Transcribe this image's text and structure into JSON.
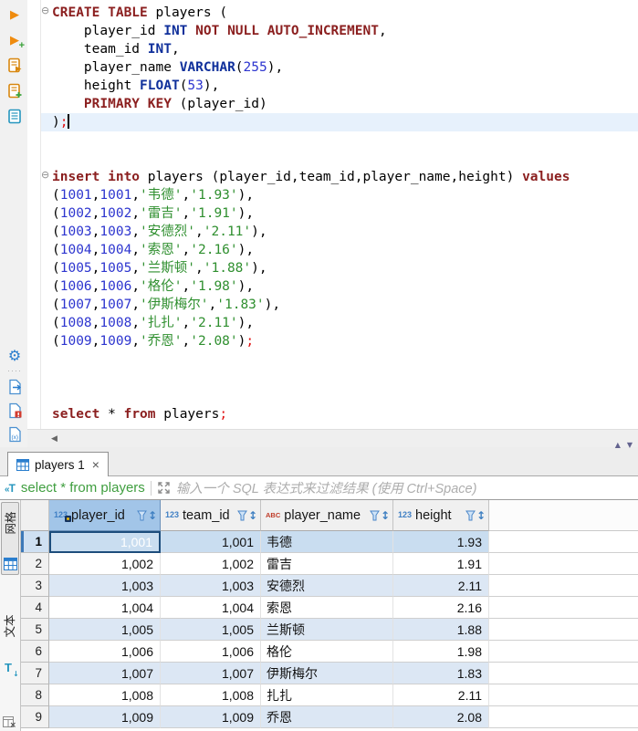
{
  "icons": {
    "play": "▶",
    "plus": "+",
    "gear": "⚙",
    "dots": "····",
    "fold": "⊖",
    "scroll_left": "◀",
    "close": "×",
    "sort": "↕",
    "panel_up": "▲",
    "panel_down": "▼",
    "filter_chevrons": "«",
    "filter_T": "T",
    "text_T": "T",
    "text_arrow": "↓"
  },
  "editor": {
    "lines": [
      {
        "fold": true,
        "tokens": [
          [
            "k",
            "CREATE TABLE"
          ],
          [
            "p",
            " players ("
          ]
        ]
      },
      {
        "tokens": [
          [
            "p",
            "    player_id "
          ],
          [
            "t",
            "INT"
          ],
          [
            "p",
            " "
          ],
          [
            "k",
            "NOT NULL AUTO_INCREMENT"
          ],
          [
            "p",
            ","
          ]
        ]
      },
      {
        "tokens": [
          [
            "p",
            "    team_id "
          ],
          [
            "t",
            "INT"
          ],
          [
            "p",
            ","
          ]
        ]
      },
      {
        "tokens": [
          [
            "p",
            "    player_name "
          ],
          [
            "t",
            "VARCHAR"
          ],
          [
            "p",
            "("
          ],
          [
            "n",
            "255"
          ],
          [
            "p",
            "),"
          ]
        ]
      },
      {
        "tokens": [
          [
            "p",
            "    height "
          ],
          [
            "t",
            "FLOAT"
          ],
          [
            "p",
            "("
          ],
          [
            "n",
            "53"
          ],
          [
            "p",
            "),"
          ]
        ]
      },
      {
        "tokens": [
          [
            "p",
            "    "
          ],
          [
            "k",
            "PRIMARY KEY"
          ],
          [
            "p",
            " (player_id)"
          ]
        ]
      },
      {
        "tokens": [
          [
            "p",
            ")"
          ],
          [
            "d",
            ";"
          ]
        ],
        "cursor": true
      },
      {
        "tokens": []
      },
      {
        "tokens": []
      },
      {
        "fold": true,
        "tokens": [
          [
            "k",
            "insert into"
          ],
          [
            "p",
            " players (player_id,team_id,player_name,height) "
          ],
          [
            "k",
            "values"
          ]
        ]
      },
      {
        "tokens": [
          [
            "p",
            "("
          ],
          [
            "n",
            "1001"
          ],
          [
            "p",
            ","
          ],
          [
            "n",
            "1001"
          ],
          [
            "p",
            ","
          ],
          [
            "s",
            "'韦德'"
          ],
          [
            "p",
            ","
          ],
          [
            "s",
            "'1.93'"
          ],
          [
            "p",
            "),"
          ]
        ]
      },
      {
        "tokens": [
          [
            "p",
            "("
          ],
          [
            "n",
            "1002"
          ],
          [
            "p",
            ","
          ],
          [
            "n",
            "1002"
          ],
          [
            "p",
            ","
          ],
          [
            "s",
            "'雷吉'"
          ],
          [
            "p",
            ","
          ],
          [
            "s",
            "'1.91'"
          ],
          [
            "p",
            "),"
          ]
        ]
      },
      {
        "tokens": [
          [
            "p",
            "("
          ],
          [
            "n",
            "1003"
          ],
          [
            "p",
            ","
          ],
          [
            "n",
            "1003"
          ],
          [
            "p",
            ","
          ],
          [
            "s",
            "'安德烈'"
          ],
          [
            "p",
            ","
          ],
          [
            "s",
            "'2.11'"
          ],
          [
            "p",
            "),"
          ]
        ]
      },
      {
        "tokens": [
          [
            "p",
            "("
          ],
          [
            "n",
            "1004"
          ],
          [
            "p",
            ","
          ],
          [
            "n",
            "1004"
          ],
          [
            "p",
            ","
          ],
          [
            "s",
            "'索恩'"
          ],
          [
            "p",
            ","
          ],
          [
            "s",
            "'2.16'"
          ],
          [
            "p",
            "),"
          ]
        ]
      },
      {
        "tokens": [
          [
            "p",
            "("
          ],
          [
            "n",
            "1005"
          ],
          [
            "p",
            ","
          ],
          [
            "n",
            "1005"
          ],
          [
            "p",
            ","
          ],
          [
            "s",
            "'兰斯顿'"
          ],
          [
            "p",
            ","
          ],
          [
            "s",
            "'1.88'"
          ],
          [
            "p",
            "),"
          ]
        ]
      },
      {
        "tokens": [
          [
            "p",
            "("
          ],
          [
            "n",
            "1006"
          ],
          [
            "p",
            ","
          ],
          [
            "n",
            "1006"
          ],
          [
            "p",
            ","
          ],
          [
            "s",
            "'格伦'"
          ],
          [
            "p",
            ","
          ],
          [
            "s",
            "'1.98'"
          ],
          [
            "p",
            "),"
          ]
        ]
      },
      {
        "tokens": [
          [
            "p",
            "("
          ],
          [
            "n",
            "1007"
          ],
          [
            "p",
            ","
          ],
          [
            "n",
            "1007"
          ],
          [
            "p",
            ","
          ],
          [
            "s",
            "'伊斯梅尔'"
          ],
          [
            "p",
            ","
          ],
          [
            "s",
            "'1.83'"
          ],
          [
            "p",
            "),"
          ]
        ]
      },
      {
        "tokens": [
          [
            "p",
            "("
          ],
          [
            "n",
            "1008"
          ],
          [
            "p",
            ","
          ],
          [
            "n",
            "1008"
          ],
          [
            "p",
            ","
          ],
          [
            "s",
            "'扎扎'"
          ],
          [
            "p",
            ","
          ],
          [
            "s",
            "'2.11'"
          ],
          [
            "p",
            "),"
          ]
        ]
      },
      {
        "tokens": [
          [
            "p",
            "("
          ],
          [
            "n",
            "1009"
          ],
          [
            "p",
            ","
          ],
          [
            "n",
            "1009"
          ],
          [
            "p",
            ","
          ],
          [
            "s",
            "'乔恩'"
          ],
          [
            "p",
            ","
          ],
          [
            "s",
            "'2.08'"
          ],
          [
            "p",
            ")"
          ],
          [
            "d",
            ";"
          ]
        ]
      },
      {
        "tokens": []
      },
      {
        "tokens": []
      },
      {
        "tokens": []
      },
      {
        "tokens": [
          [
            "k",
            "select"
          ],
          [
            "p",
            " * "
          ],
          [
            "k",
            "from"
          ],
          [
            "p",
            " players"
          ],
          [
            "d",
            ";"
          ]
        ]
      }
    ]
  },
  "results": {
    "tab": {
      "label": "players 1"
    },
    "filter": {
      "query": "select * from players",
      "placeholder": "输入一个 SQL 表达式来过滤结果 (使用 Ctrl+Space)"
    },
    "side_tabs": [
      {
        "label": "网格"
      },
      {
        "label": "文本"
      }
    ],
    "grid": {
      "columns": [
        {
          "name": "player_id",
          "type": "123",
          "key": true,
          "selected": true
        },
        {
          "name": "team_id",
          "type": "123"
        },
        {
          "name": "player_name",
          "type": "ABC"
        },
        {
          "name": "height",
          "type": "123"
        }
      ],
      "rows": [
        {
          "num": "1",
          "player_id": "1,001",
          "team_id": "1,001",
          "player_name": "韦德",
          "height": "1.93",
          "selected": true
        },
        {
          "num": "2",
          "player_id": "1,002",
          "team_id": "1,002",
          "player_name": "雷吉",
          "height": "1.91"
        },
        {
          "num": "3",
          "player_id": "1,003",
          "team_id": "1,003",
          "player_name": "安德烈",
          "height": "2.11"
        },
        {
          "num": "4",
          "player_id": "1,004",
          "team_id": "1,004",
          "player_name": "索恩",
          "height": "2.16"
        },
        {
          "num": "5",
          "player_id": "1,005",
          "team_id": "1,005",
          "player_name": "兰斯顿",
          "height": "1.88"
        },
        {
          "num": "6",
          "player_id": "1,006",
          "team_id": "1,006",
          "player_name": "格伦",
          "height": "1.98"
        },
        {
          "num": "7",
          "player_id": "1,007",
          "team_id": "1,007",
          "player_name": "伊斯梅尔",
          "height": "1.83"
        },
        {
          "num": "8",
          "player_id": "1,008",
          "team_id": "1,008",
          "player_name": "扎扎",
          "height": "2.11"
        },
        {
          "num": "9",
          "player_id": "1,009",
          "team_id": "1,009",
          "player_name": "乔恩",
          "height": "2.08"
        }
      ]
    }
  },
  "colors": {
    "keyword": "#8b1f1f",
    "datatype": "#10309b",
    "number": "#2d35cf",
    "string": "#2f8f2f",
    "delimiter": "#e01010",
    "selection": "#4f93d3",
    "stripe": "#dce7f4",
    "accent_blue": "#2a7ece"
  }
}
